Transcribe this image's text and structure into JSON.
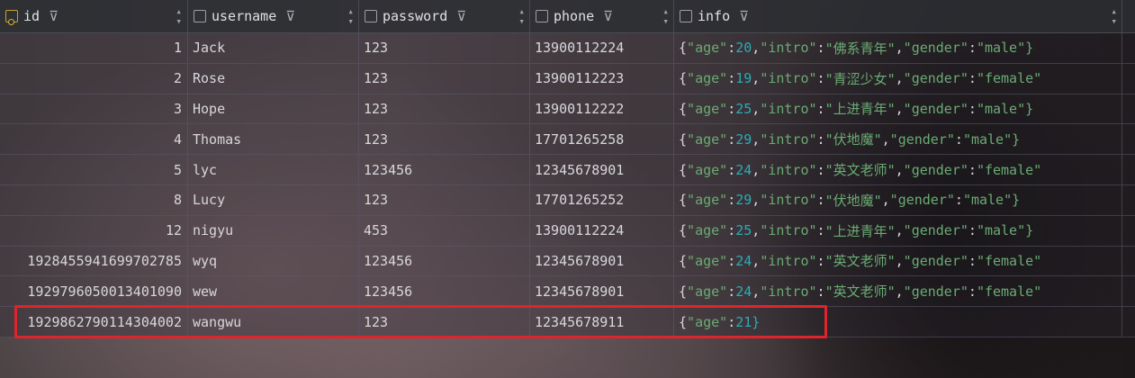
{
  "columns": [
    {
      "label": "id",
      "icon": "primary-key-icon"
    },
    {
      "label": "username",
      "icon": "column-icon"
    },
    {
      "label": "password",
      "icon": "column-icon"
    },
    {
      "label": "phone",
      "icon": "column-icon"
    },
    {
      "label": "info",
      "icon": "column-icon"
    }
  ],
  "rows": [
    {
      "id": "1",
      "username": "Jack",
      "password": "123",
      "phone": "13900112224",
      "info": [
        [
          "age",
          "20",
          "num"
        ],
        [
          "intro",
          "\"佛系青年\"",
          "str"
        ],
        [
          "gender",
          "\"male\"}",
          "str"
        ]
      ]
    },
    {
      "id": "2",
      "username": "Rose",
      "password": "123",
      "phone": "13900112223",
      "info": [
        [
          "age",
          "19",
          "num"
        ],
        [
          "intro",
          "\"青涩少女\"",
          "str"
        ],
        [
          "gender",
          "\"female\"",
          "str"
        ]
      ]
    },
    {
      "id": "3",
      "username": "Hope",
      "password": "123",
      "phone": "13900112222",
      "info": [
        [
          "age",
          "25",
          "num"
        ],
        [
          "intro",
          "\"上进青年\"",
          "str"
        ],
        [
          "gender",
          "\"male\"}",
          "str"
        ]
      ]
    },
    {
      "id": "4",
      "username": "Thomas",
      "password": "123",
      "phone": "17701265258",
      "info": [
        [
          "age",
          "29",
          "num"
        ],
        [
          "intro",
          "\"伏地魔\"",
          "str"
        ],
        [
          "gender",
          "\"male\"}",
          "str"
        ]
      ]
    },
    {
      "id": "5",
      "username": "lyc",
      "password": "123456",
      "phone": "12345678901",
      "info": [
        [
          "age",
          "24",
          "num"
        ],
        [
          "intro",
          "\"英文老师\"",
          "str"
        ],
        [
          "gender",
          "\"female\"",
          "str"
        ]
      ]
    },
    {
      "id": "8",
      "username": "Lucy",
      "password": "123",
      "phone": "17701265252",
      "info": [
        [
          "age",
          "29",
          "num"
        ],
        [
          "intro",
          "\"伏地魔\"",
          "str"
        ],
        [
          "gender",
          "\"male\"}",
          "str"
        ]
      ]
    },
    {
      "id": "12",
      "username": "nigyu",
      "password": "453",
      "phone": "13900112224",
      "info": [
        [
          "age",
          "25",
          "num"
        ],
        [
          "intro",
          "\"上进青年\"",
          "str"
        ],
        [
          "gender",
          "\"male\"}",
          "str"
        ]
      ]
    },
    {
      "id": "1928455941699702785",
      "username": "wyq",
      "password": "123456",
      "phone": "12345678901",
      "info": [
        [
          "age",
          "24",
          "num"
        ],
        [
          "intro",
          "\"英文老师\"",
          "str"
        ],
        [
          "gender",
          "\"female\"",
          "str"
        ]
      ]
    },
    {
      "id": "1929796050013401090",
      "username": "wew",
      "password": "123456",
      "phone": "12345678901",
      "info": [
        [
          "age",
          "24",
          "num"
        ],
        [
          "intro",
          "\"英文老师\"",
          "str"
        ],
        [
          "gender",
          "\"female\"",
          "str"
        ]
      ]
    },
    {
      "id": "1929862790114304002",
      "username": "wangwu",
      "password": "123",
      "phone": "12345678911",
      "info": [
        [
          "age",
          "21}",
          "num"
        ]
      ]
    }
  ],
  "highlight_row": 9,
  "colors": {
    "highlight": "#e0242c",
    "json_key": "#6aab73",
    "json_number": "#2aacb8"
  }
}
